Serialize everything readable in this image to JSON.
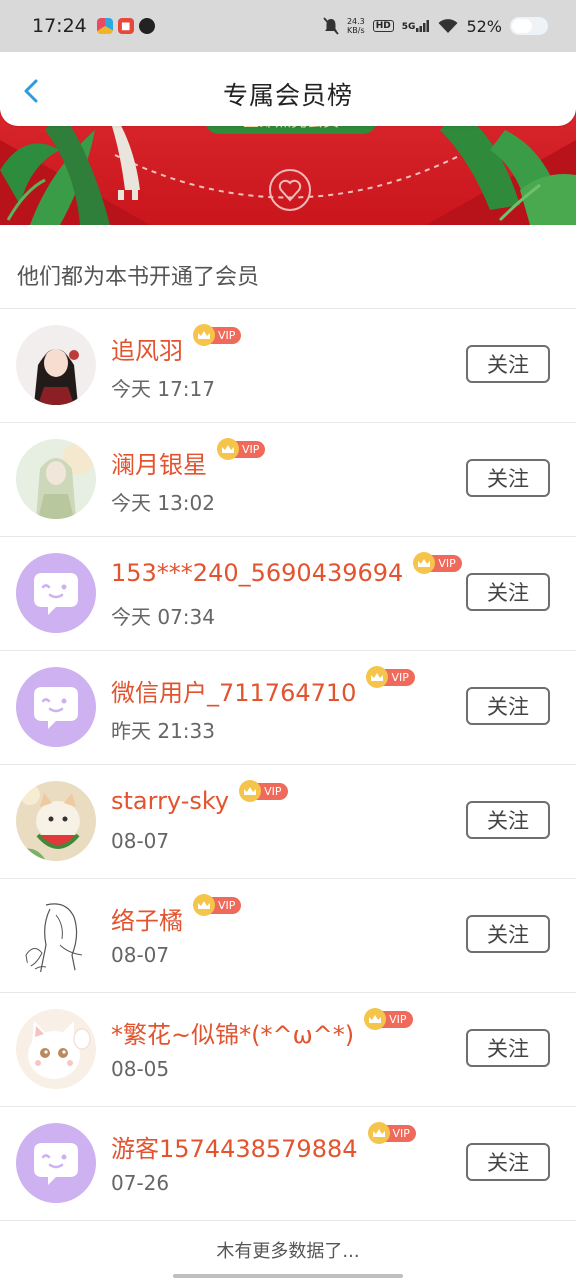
{
  "status_bar": {
    "time": "17:24",
    "net_speed_value": "24.3",
    "net_speed_unit": "KB/s",
    "hd": "HD",
    "network": "5G",
    "battery": "52%"
  },
  "header": {
    "back_icon": "chevron-left-icon",
    "title": "专属会员榜"
  },
  "banner": {
    "cta_label": "立即点亮会员"
  },
  "section_title": "他们都为本书开通了会员",
  "follow_label": "关注",
  "vip_label": "VIP",
  "members": [
    {
      "name": "追风羽",
      "time": "今天 17:17",
      "avatar": "illustrated-character-avatar"
    },
    {
      "name": "澜月银星",
      "time": "今天 13:02",
      "avatar": "illustrated-girl-avatar"
    },
    {
      "name": "153***240_5690439694",
      "time": "今天 07:34",
      "avatar": "default-chat-avatar"
    },
    {
      "name": "微信用户_711764710",
      "time": "昨天 21:33",
      "avatar": "default-chat-avatar"
    },
    {
      "name": "starry-sky",
      "time": "08-07",
      "avatar": "cat-watermelon-avatar"
    },
    {
      "name": "络子橘",
      "time": "08-07",
      "avatar": "sketch-girl-avatar"
    },
    {
      "name": "*繁花~似锦*(*^ω^*)",
      "time": "08-05",
      "avatar": "white-cat-avatar"
    },
    {
      "name": "游客1574438579884",
      "time": "07-26",
      "avatar": "default-chat-avatar"
    }
  ],
  "footer": "木有更多数据了...",
  "colors": {
    "accent_name": "#e2542f",
    "vip_tag": "#ef6a5a",
    "crown": "#f4c54a",
    "banner_red": "#d8262c",
    "default_avatar": "#cdb1f0",
    "back_icon": "#2e9bdc"
  }
}
